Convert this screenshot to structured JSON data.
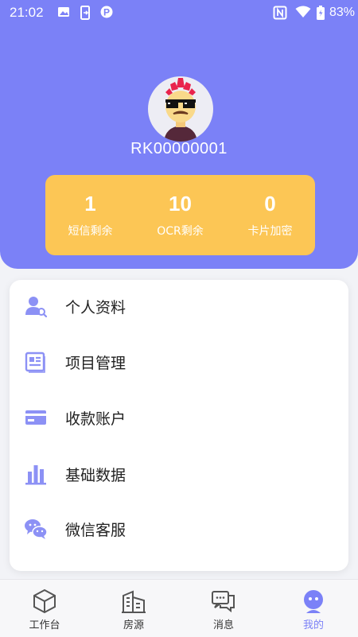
{
  "status_bar": {
    "time": "21:02",
    "battery": "83%"
  },
  "profile": {
    "username": "RK00000001"
  },
  "stats": [
    {
      "value": "1",
      "label": "短信剩余"
    },
    {
      "value": "10",
      "label": "OCR剩余"
    },
    {
      "value": "0",
      "label": "卡片加密"
    }
  ],
  "menu": [
    {
      "label": "个人资料",
      "icon": "user-search-icon"
    },
    {
      "label": "项目管理",
      "icon": "document-list-icon"
    },
    {
      "label": "收款账户",
      "icon": "card-icon"
    },
    {
      "label": "基础数据",
      "icon": "bar-chart-icon"
    },
    {
      "label": "微信客服",
      "icon": "wechat-icon"
    }
  ],
  "tabs": [
    {
      "label": "工作台",
      "icon": "cube-icon",
      "active": false
    },
    {
      "label": "房源",
      "icon": "building-icon",
      "active": false
    },
    {
      "label": "消息",
      "icon": "chat-icon",
      "active": false
    },
    {
      "label": "我的",
      "icon": "profile-icon",
      "active": true
    }
  ],
  "colors": {
    "primary": "#7b81f7",
    "stats_card": "#fcc655",
    "icon": "#8c91f5"
  }
}
